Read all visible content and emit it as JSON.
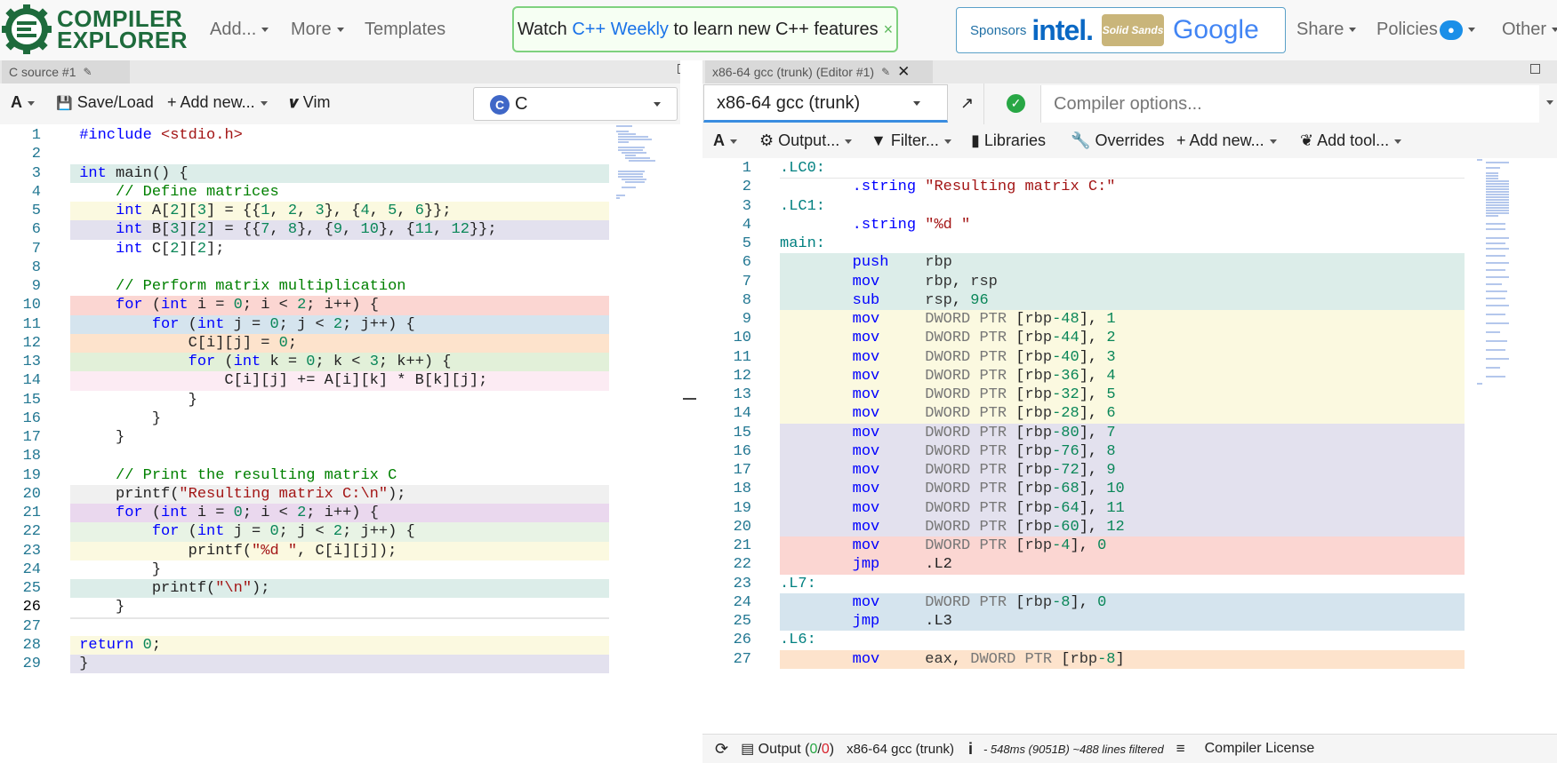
{
  "nav": {
    "logo_line1": "COMPILER",
    "logo_line2": "EXPLORER",
    "add": "Add...",
    "more": "More",
    "templates": "Templates",
    "motd_prefix": "Watch ",
    "motd_link": "C++ Weekly",
    "motd_suffix": " to learn new C++ features",
    "motd_close": "×",
    "sponsors_label": "Sponsors",
    "sponsor_1": "intel.",
    "sponsor_2": "Solid Sands",
    "sponsor_3": "Google",
    "share": "Share",
    "policies": "Policies",
    "other": "Other"
  },
  "editor": {
    "tab_title": "C source #1",
    "font_btn": "A",
    "save_load": "Save/Load",
    "add_new": "Add new...",
    "vim": "Vim",
    "language": "C",
    "lines": [
      "#include <stdio.h>",
      "",
      "int main() {",
      "    // Define matrices",
      "    int A[2][3] = {{1, 2, 3}, {4, 5, 6}};",
      "    int B[3][2] = {{7, 8}, {9, 10}, {11, 12}};",
      "    int C[2][2];",
      "",
      "    // Perform matrix multiplication",
      "    for (int i = 0; i < 2; i++) {",
      "        for (int j = 0; j < 2; j++) {",
      "            C[i][j] = 0;",
      "            for (int k = 0; k < 3; k++) {",
      "                C[i][j] += A[i][k] * B[k][j];",
      "            }",
      "        }",
      "    }",
      "",
      "    // Print the resulting matrix C",
      "    printf(\"Resulting matrix C:\\n\");",
      "    for (int i = 0; i < 2; i++) {",
      "        for (int j = 0; j < 2; j++) {",
      "            printf(\"%d \", C[i][j]);",
      "        }",
      "        printf(\"\\n\");",
      "    }",
      "",
      "return 0;",
      "}"
    ]
  },
  "compiler": {
    "tab_title": "x86-64 gcc (trunk) (Editor #1)",
    "compiler_name": "x86-64 gcc (trunk)",
    "options_placeholder": "Compiler options...",
    "font_btn": "A",
    "output": "Output...",
    "filter": "Filter...",
    "libraries": "Libraries",
    "overrides": "Overrides",
    "add_new": "Add new...",
    "add_tool": "Add tool...",
    "asm_lines": [
      ".LC0:",
      "        .string \"Resulting matrix C:\"",
      ".LC1:",
      "        .string \"%d \"",
      "main:",
      "        push    rbp",
      "        mov     rbp, rsp",
      "        sub     rsp, 96",
      "        mov     DWORD PTR [rbp-48], 1",
      "        mov     DWORD PTR [rbp-44], 2",
      "        mov     DWORD PTR [rbp-40], 3",
      "        mov     DWORD PTR [rbp-36], 4",
      "        mov     DWORD PTR [rbp-32], 5",
      "        mov     DWORD PTR [rbp-28], 6",
      "        mov     DWORD PTR [rbp-80], 7",
      "        mov     DWORD PTR [rbp-76], 8",
      "        mov     DWORD PTR [rbp-72], 9",
      "        mov     DWORD PTR [rbp-68], 10",
      "        mov     DWORD PTR [rbp-64], 11",
      "        mov     DWORD PTR [rbp-60], 12",
      "        mov     DWORD PTR [rbp-4], 0",
      "        jmp     .L2",
      ".L7:",
      "        mov     DWORD PTR [rbp-8], 0",
      "        jmp     .L3",
      ".L6:",
      "        mov     eax, DWORD PTR [rbp-8]"
    ],
    "status_output": "Output (",
    "status_output_ok": "0",
    "status_output_sep": "/",
    "status_output_err": "0",
    "status_output_end": ")",
    "status_compiler": "x86-64 gcc (trunk)",
    "status_info": "- 548ms (9051B) ~488 lines filtered",
    "status_license": "Compiler License"
  },
  "colors": {
    "teal": "#dcede9",
    "yellow": "#fbf9e0",
    "lavender": "#e3e1ee",
    "red": "#fbd6d2",
    "blue": "#d5e4ee",
    "orange": "#fde3cc",
    "green": "#e2f0d9",
    "pink": "#fcebf3",
    "grey": "#f0f0f0",
    "purple": "#ead8ee",
    "lightgreen": "#e8f3e5"
  }
}
